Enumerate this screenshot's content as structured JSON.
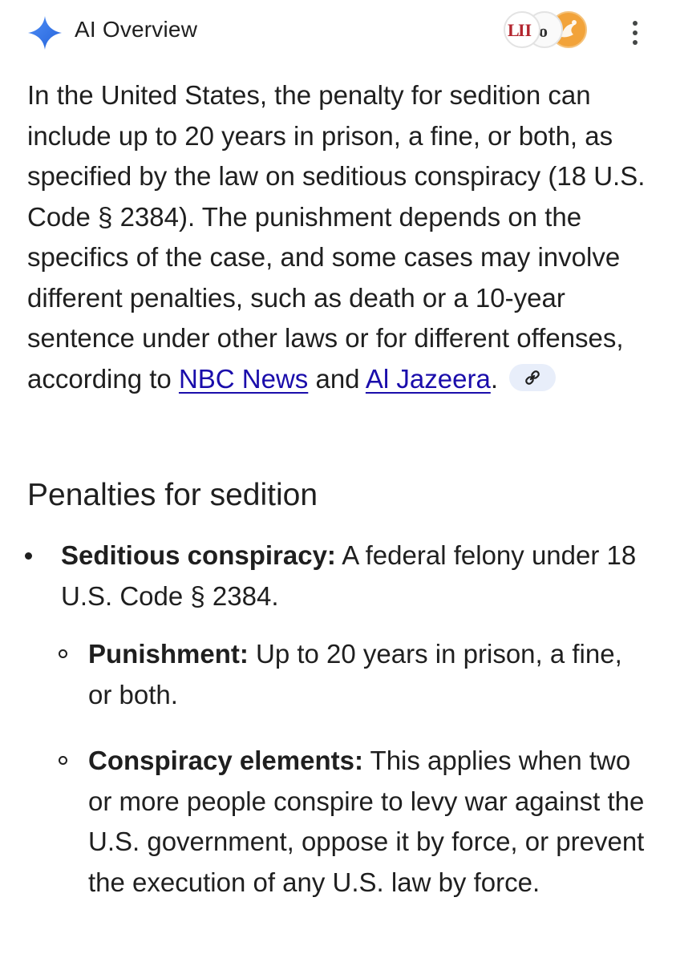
{
  "header": {
    "title": "AI Overview",
    "sources": [
      "LII",
      "NBC",
      "Al Jazeera"
    ],
    "menu_icon": "more-vert-icon"
  },
  "summary": {
    "text_before": "In the United States, the penalty for sedition can include up to 20 years in prison, a fine, or both, as specified by the law on seditious conspiracy (18 U.S. Code § 2384). The punishment depends on the specifics of the case, and some cases may involve different penalties, such as death or a 10-year sentence under other laws or for different offenses, according to ",
    "link1": "NBC News",
    "text_between": " and ",
    "link2": "Al Jazeera",
    "text_after": ".",
    "chip_icon": "link-icon"
  },
  "section": {
    "title": "Penalties for sedition"
  },
  "items": [
    {
      "term": "Seditious conspiracy:",
      "text": " A federal felony under 18 U.S. Code § 2384.",
      "subitems": [
        {
          "term": "Punishment:",
          "text": " Up to 20 years in prison, a fine, or both."
        },
        {
          "term": "Conspiracy elements:",
          "text": " This applies when two or more people conspire to levy war against the U.S. government, oppose it by force, or prevent the execution of any U.S. law by force."
        }
      ]
    }
  ],
  "colors": {
    "accent": "#4285f4",
    "link": "#1a0dab",
    "text": "#1f1f1f",
    "chip_bg": "#e8eefa"
  }
}
